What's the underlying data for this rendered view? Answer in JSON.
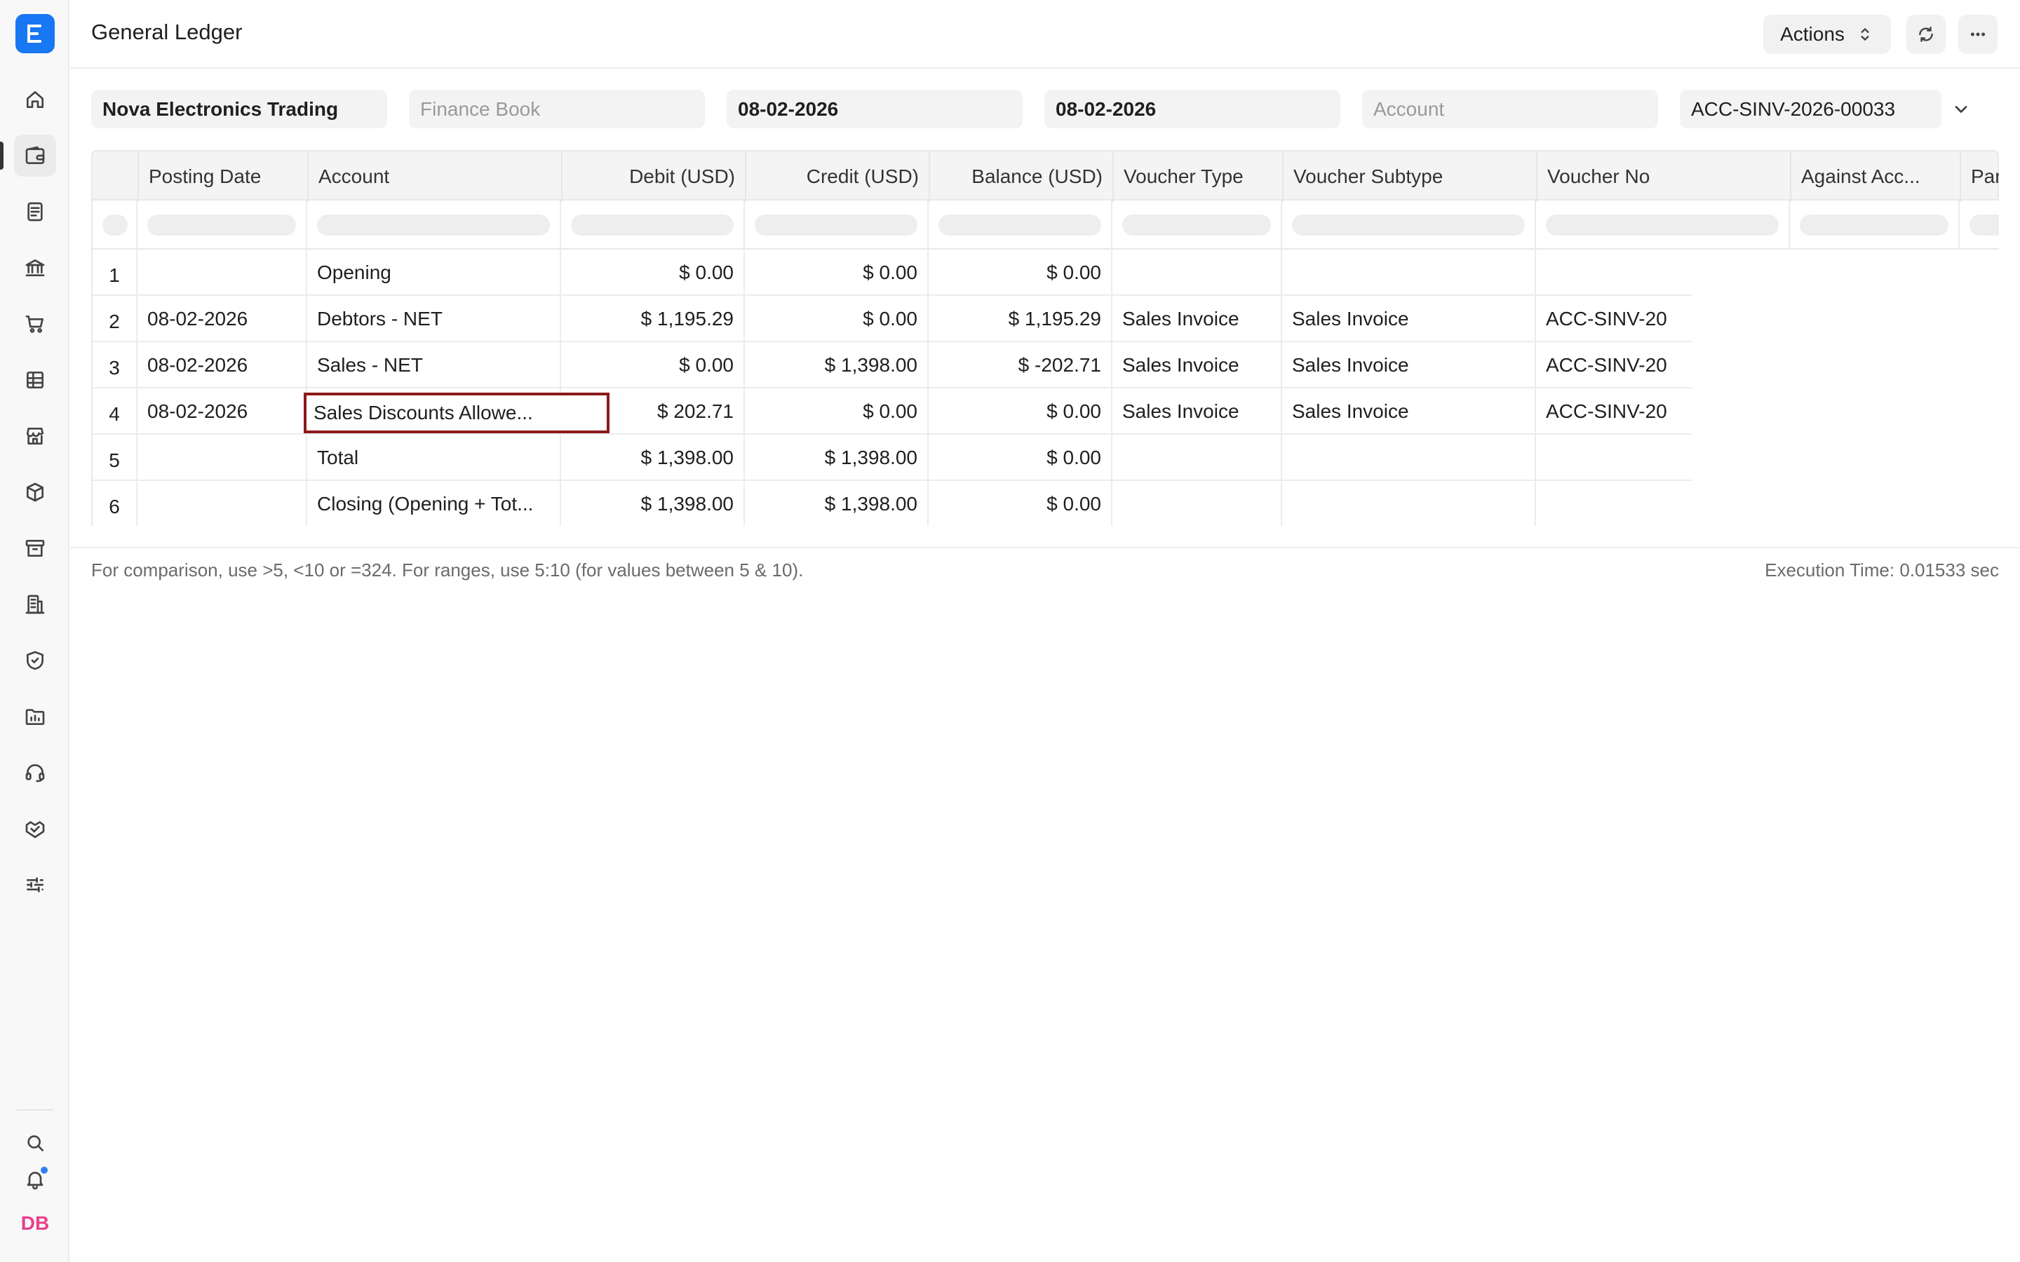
{
  "app": {
    "logo_letter": "E",
    "user_initials": "DB"
  },
  "sidebar": {
    "items": [
      {
        "icon": "home-icon"
      },
      {
        "icon": "wallet-icon",
        "active": true
      },
      {
        "icon": "document-icon"
      },
      {
        "icon": "bank-icon"
      },
      {
        "icon": "cart-icon"
      },
      {
        "icon": "table-icon"
      },
      {
        "icon": "store-icon"
      },
      {
        "icon": "box-icon"
      },
      {
        "icon": "archive-icon"
      },
      {
        "icon": "building-icon"
      },
      {
        "icon": "shield-icon"
      },
      {
        "icon": "folder-chart-icon"
      },
      {
        "icon": "headset-icon"
      },
      {
        "icon": "handshake-icon"
      },
      {
        "icon": "sliders-icon"
      }
    ],
    "bottom": [
      {
        "icon": "search-icon"
      },
      {
        "icon": "bell-icon"
      }
    ]
  },
  "header": {
    "title": "General Ledger",
    "actions_label": "Actions"
  },
  "filters": {
    "company": "Nova Electronics Trading",
    "finance_book_placeholder": "Finance Book",
    "from_date": "08-02-2026",
    "to_date": "08-02-2026",
    "account_placeholder": "Account",
    "voucher_no": "ACC-SINV-2026-00033"
  },
  "table": {
    "columns": [
      "Posting Date",
      "Account",
      "Debit (USD)",
      "Credit (USD)",
      "Balance (USD)",
      "Voucher Type",
      "Voucher Subtype",
      "Voucher No",
      "Against Acc...",
      "Par"
    ],
    "rows": [
      {
        "idx": "1",
        "posting_date": "",
        "account": "Opening",
        "debit": "$ 0.00",
        "credit": "$ 0.00",
        "balance": "$ 0.00",
        "voucher_type": "",
        "voucher_subtype": "",
        "voucher_no": ""
      },
      {
        "idx": "2",
        "posting_date": "08-02-2026",
        "account": "Debtors - NET",
        "debit": "$ 1,195.29",
        "credit": "$ 0.00",
        "balance": "$ 1,195.29",
        "voucher_type": "Sales Invoice",
        "voucher_subtype": "Sales Invoice",
        "voucher_no": "ACC-SINV-20"
      },
      {
        "idx": "3",
        "posting_date": "08-02-2026",
        "account": "Sales - NET",
        "debit": "$ 0.00",
        "credit": "$ 1,398.00",
        "balance": "$ -202.71",
        "voucher_type": "Sales Invoice",
        "voucher_subtype": "Sales Invoice",
        "voucher_no": "ACC-SINV-20"
      },
      {
        "idx": "4",
        "posting_date": "08-02-2026",
        "account": "Sales Discounts Allowe...",
        "debit": "$ 202.71",
        "credit": "$ 0.00",
        "balance": "$ 0.00",
        "voucher_type": "Sales Invoice",
        "voucher_subtype": "Sales Invoice",
        "voucher_no": "ACC-SINV-20"
      },
      {
        "idx": "5",
        "posting_date": "",
        "account": "Total",
        "debit": "$ 1,398.00",
        "credit": "$ 1,398.00",
        "balance": "$ 0.00",
        "voucher_type": "",
        "voucher_subtype": "",
        "voucher_no": ""
      },
      {
        "idx": "6",
        "posting_date": "",
        "account": "Closing (Opening + Tot...",
        "debit": "$ 1,398.00",
        "credit": "$ 1,398.00",
        "balance": "$ 0.00",
        "voucher_type": "",
        "voucher_subtype": "",
        "voucher_no": ""
      }
    ]
  },
  "footer": {
    "note": "For comparison, use >5, <10 or =324. For ranges, use 5:10 (for values between 5 & 10).",
    "execution_time": "Execution Time: 0.01533 sec"
  }
}
